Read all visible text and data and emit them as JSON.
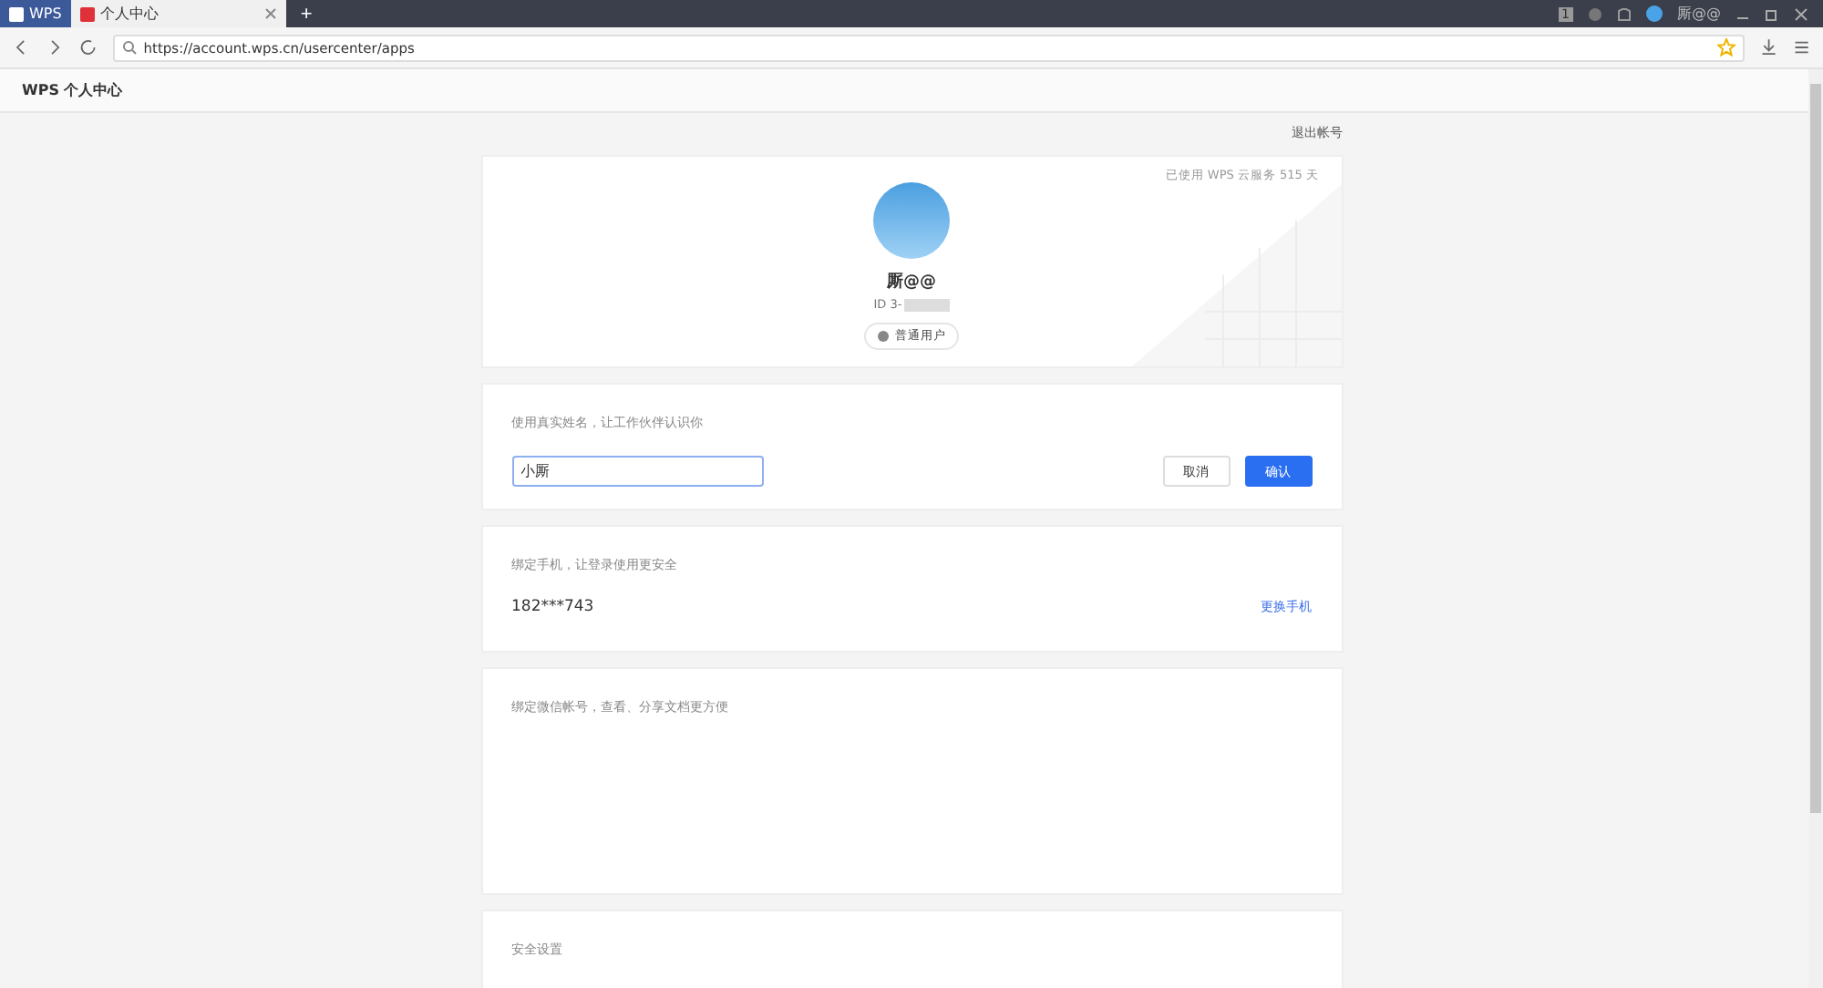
{
  "browser": {
    "tabs": [
      {
        "label": "WPS",
        "selected": false
      },
      {
        "label": "个人中心",
        "selected": true
      }
    ],
    "new_tab": "+",
    "page_count": "1",
    "user_name": "厮@@",
    "address": "https://account.wps.cn/usercenter/apps"
  },
  "header": {
    "title": "WPS 个人中心"
  },
  "logout": "退出帐号",
  "profile": {
    "usage": "已使用 WPS 云服务 515 天",
    "name": "厮@@",
    "id": "ID 3-",
    "role": "普通用户"
  },
  "name_card": {
    "hint": "使用真实姓名，让工作伙伴认识你",
    "value": "小厮",
    "buttons": [
      {
        "label": "取消",
        "kind": "secondary"
      },
      {
        "label": "确认",
        "kind": "primary"
      }
    ]
  },
  "phone_card": {
    "hint": "绑定手机，让登录使用更安全",
    "phone": "182***743",
    "action": "更换手机"
  },
  "wechat_card": {
    "hint": "绑定微信帐号，查看、分享文档更方便"
  },
  "security_card": {
    "title": "安全设置"
  }
}
